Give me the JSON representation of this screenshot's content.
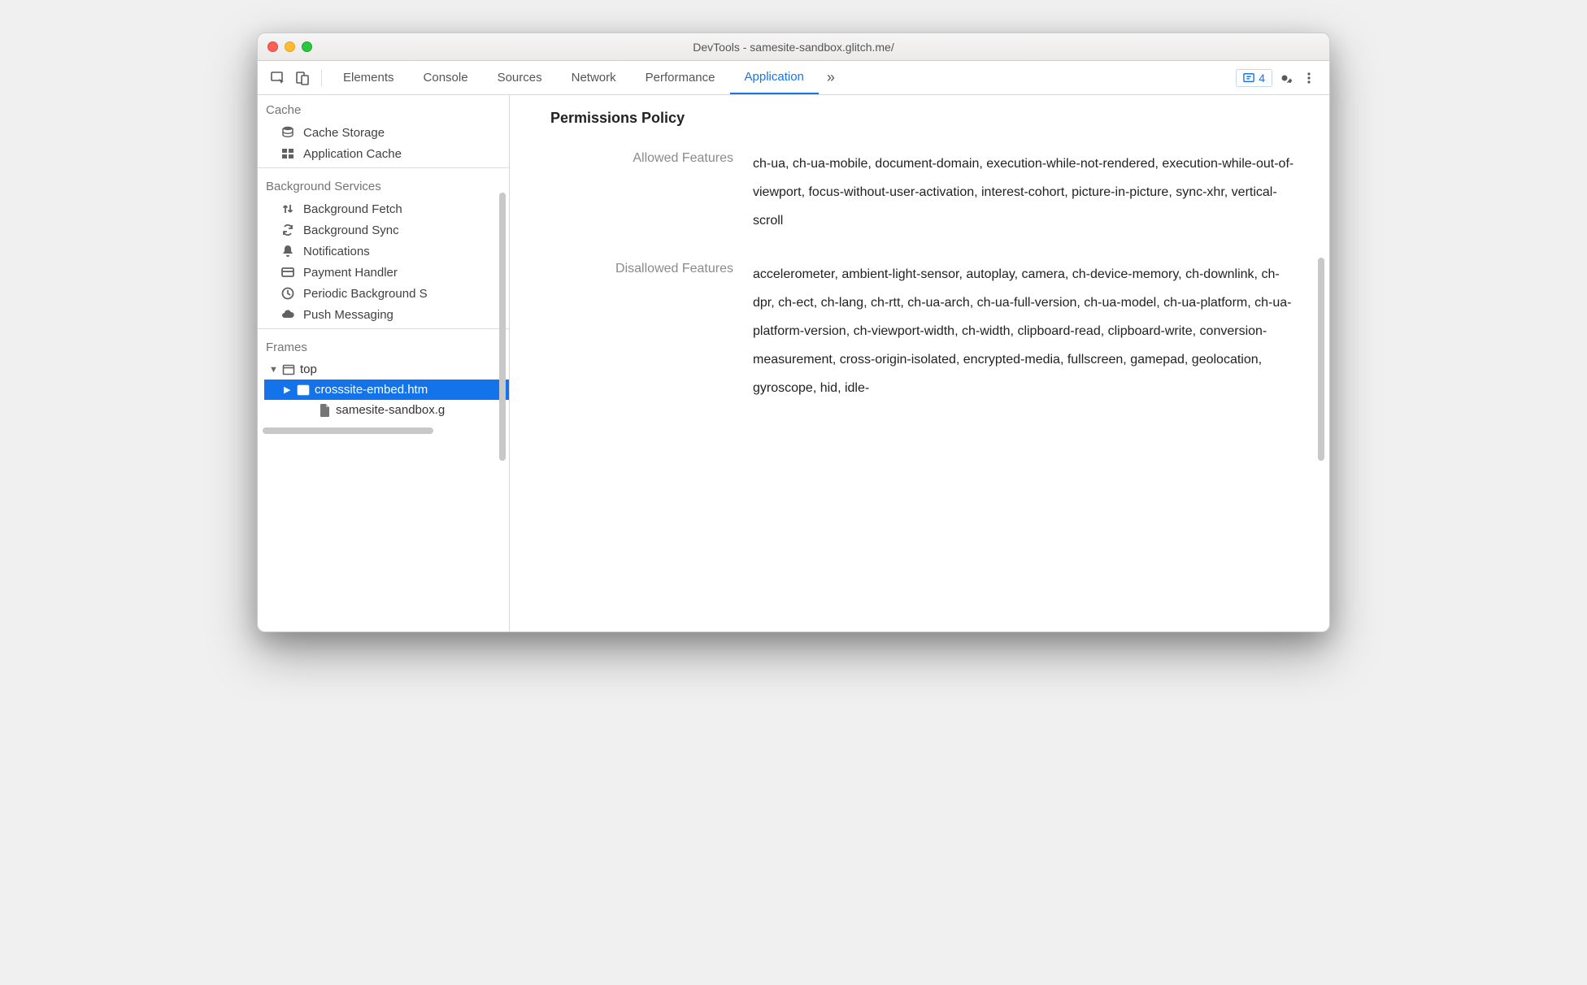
{
  "window": {
    "title": "DevTools - samesite-sandbox.glitch.me/"
  },
  "tabs": {
    "items": [
      "Elements",
      "Console",
      "Sources",
      "Network",
      "Performance",
      "Application"
    ],
    "active": "Application",
    "overflow": "»"
  },
  "issues": {
    "count": "4"
  },
  "sidebar": {
    "cache": {
      "header": "Cache",
      "items": [
        {
          "icon": "db-icon",
          "label": "Cache Storage"
        },
        {
          "icon": "grid-icon",
          "label": "Application Cache"
        }
      ]
    },
    "bgservices": {
      "header": "Background Services",
      "items": [
        {
          "icon": "updown-icon",
          "label": "Background Fetch"
        },
        {
          "icon": "sync-icon",
          "label": "Background Sync"
        },
        {
          "icon": "bell-icon",
          "label": "Notifications"
        },
        {
          "icon": "card-icon",
          "label": "Payment Handler"
        },
        {
          "icon": "clock-icon",
          "label": "Periodic Background S"
        },
        {
          "icon": "cloud-icon",
          "label": "Push Messaging"
        }
      ]
    },
    "frames": {
      "header": "Frames",
      "tree": [
        {
          "depth": 0,
          "disclosure": "▼",
          "icon": "window-icon",
          "label": "top",
          "selected": false
        },
        {
          "depth": 1,
          "disclosure": "▶",
          "icon": "frame-icon",
          "label": "crosssite-embed.htm",
          "selected": true
        },
        {
          "depth": 2,
          "disclosure": "",
          "icon": "file-icon",
          "label": "samesite-sandbox.g",
          "selected": false
        }
      ]
    }
  },
  "panel": {
    "heading": "Permissions Policy",
    "allowed_label": "Allowed Features",
    "allowed_value": "ch-ua, ch-ua-mobile, document-domain, execution-while-not-rendered, execution-while-out-of-viewport, focus-without-user-activation, interest-cohort, picture-in-picture, sync-xhr, vertical-scroll",
    "disallowed_label": "Disallowed Features",
    "disallowed_value": "accelerometer, ambient-light-sensor, autoplay, camera, ch-device-memory, ch-downlink, ch-dpr, ch-ect, ch-lang, ch-rtt, ch-ua-arch, ch-ua-full-version, ch-ua-model, ch-ua-platform, ch-ua-platform-version, ch-viewport-width, ch-width, clipboard-read, clipboard-write, conversion-measurement, cross-origin-isolated, encrypted-media, fullscreen, gamepad, geolocation, gyroscope, hid, idle-"
  }
}
